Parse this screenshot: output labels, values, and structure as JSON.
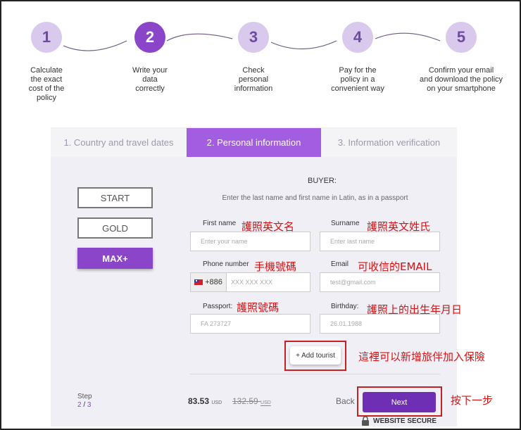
{
  "steps": [
    {
      "num": "1",
      "text": [
        "Calculate",
        "the exact",
        "cost of the",
        "policy"
      ]
    },
    {
      "num": "2",
      "text": [
        "Write your",
        "data",
        "correctly"
      ]
    },
    {
      "num": "3",
      "text": [
        "Check",
        "personal",
        "information"
      ]
    },
    {
      "num": "4",
      "text": [
        "Pay for the",
        "policy in a",
        "convenient way"
      ]
    },
    {
      "num": "5",
      "text": [
        "Confirm your email",
        "and download the policy",
        "on your smartphone"
      ]
    }
  ],
  "tabs": [
    "1. Country and travel dates",
    "2. Personal information",
    "3. Information verification"
  ],
  "plans": [
    "START",
    "GOLD",
    "MAX+"
  ],
  "buyer": {
    "heading": "BUYER:",
    "instruction": "Enter the last name and first name in Latin, as in a passport"
  },
  "fields": {
    "first_name": {
      "label": "First name",
      "placeholder": "Enter your name",
      "note": "護照英文名"
    },
    "surname": {
      "label": "Surname",
      "placeholder": "Enter last name",
      "note": "護照英文姓氏"
    },
    "phone": {
      "label": "Phone number",
      "code": "+886",
      "placeholder": "XXX XXX XXX",
      "note": "手機號碼"
    },
    "email": {
      "label": "Email",
      "placeholder": "test@gmail.com",
      "note": "可收信的EMAIL"
    },
    "passport": {
      "label": "Passport:",
      "placeholder": "FA 273727",
      "note": "護照號碼"
    },
    "birthday": {
      "label": "Birthday:",
      "placeholder": "26.01.1988",
      "note": "護照上的出生年月日"
    }
  },
  "add_tourist": {
    "label": "+ Add tourist",
    "note": "這裡可以新增旅伴加入保險"
  },
  "footer": {
    "step_label": "Step",
    "step_current": "2",
    "step_sep": "/",
    "step_total": "3",
    "price": "83.53",
    "price_currency": "USD",
    "old_price": "132.59",
    "old_currency": "USD",
    "back": "Back",
    "next": "Next",
    "next_note": "按下一步",
    "secure": "WEBSITE SECURE"
  }
}
